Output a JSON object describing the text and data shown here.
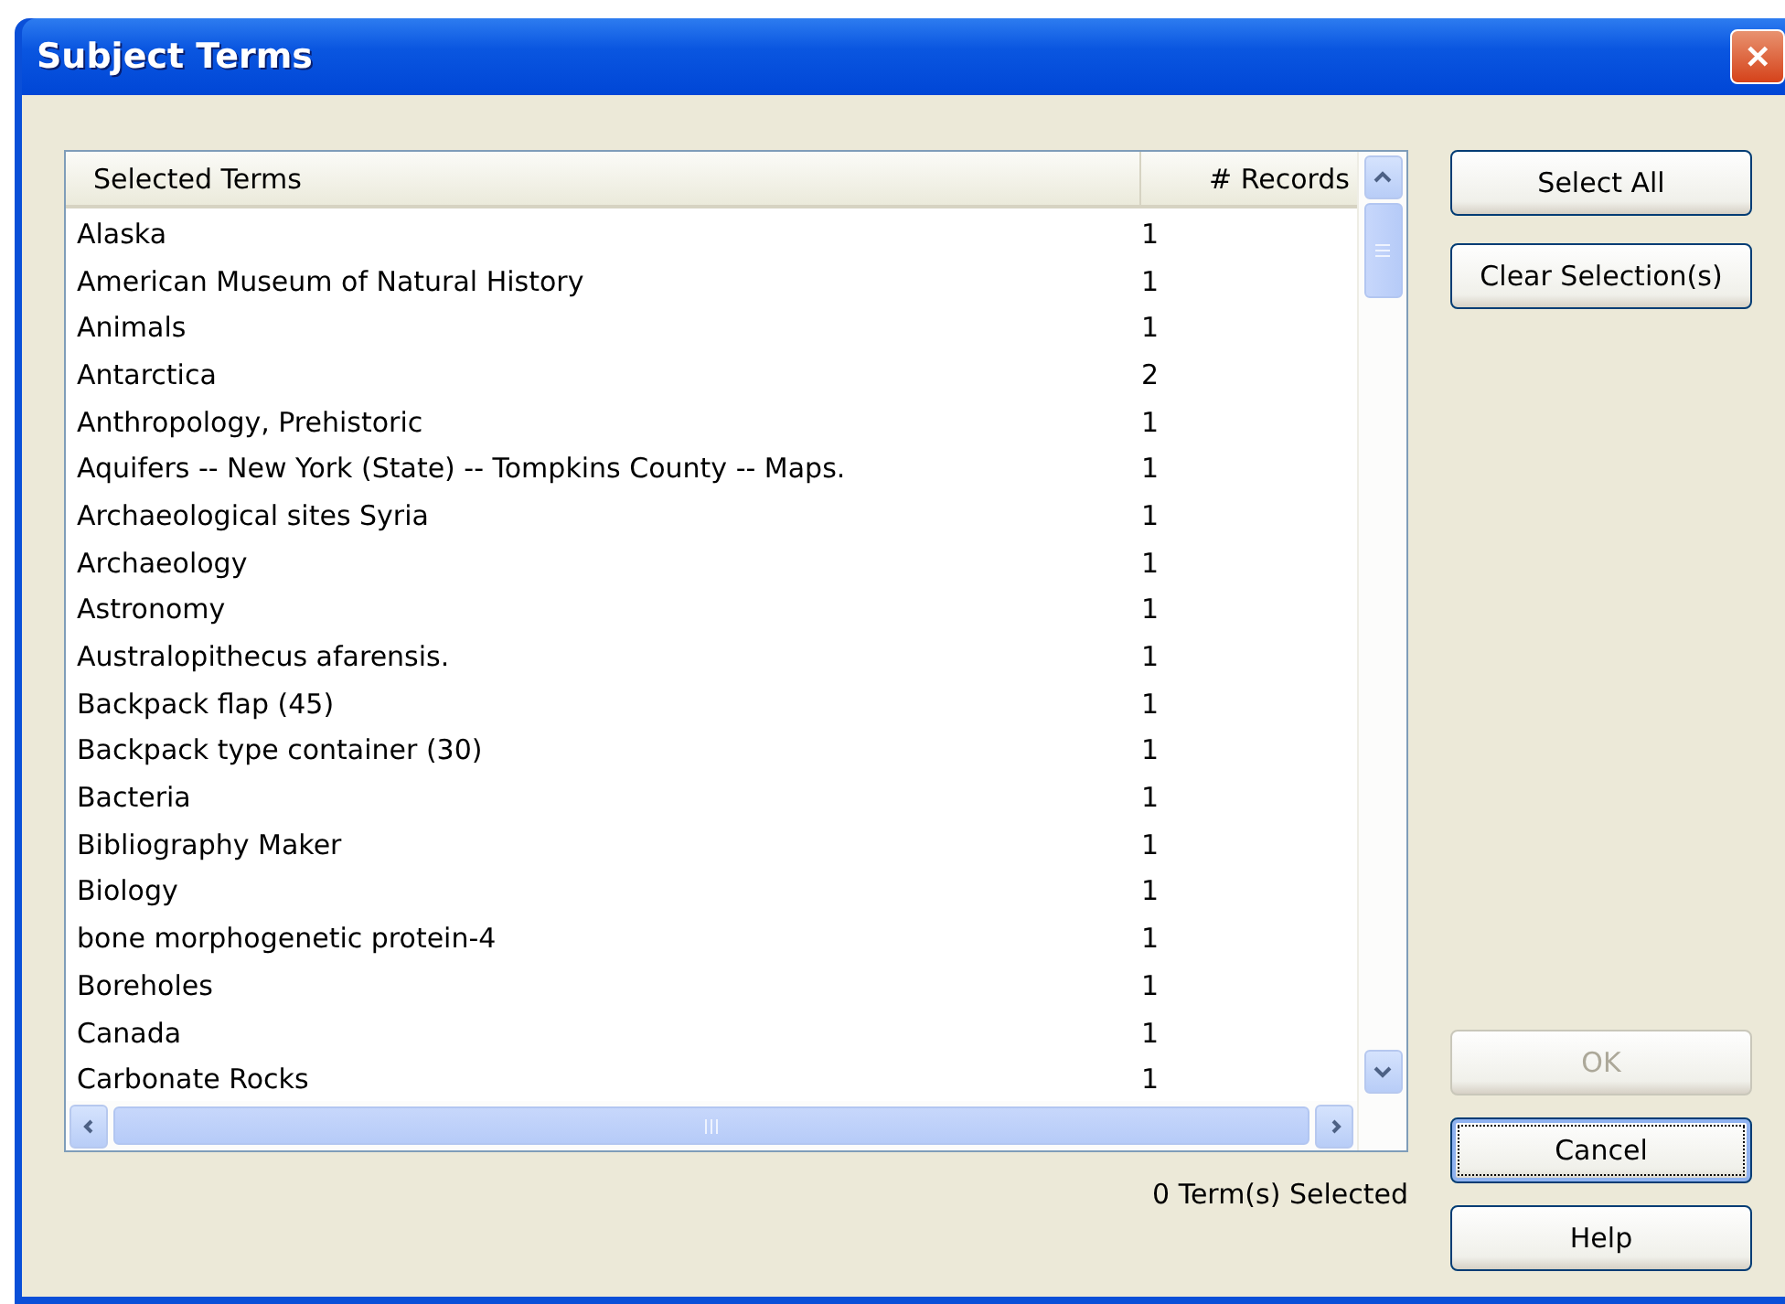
{
  "window": {
    "title": "Subject Terms",
    "close": "✕"
  },
  "table": {
    "columns": [
      "Selected Terms",
      "# Records"
    ],
    "rows": [
      {
        "term": "Alaska",
        "records": "1"
      },
      {
        "term": "American Museum of Natural History",
        "records": "1"
      },
      {
        "term": "Animals",
        "records": "1"
      },
      {
        "term": "Antarctica",
        "records": "2"
      },
      {
        "term": "Anthropology, Prehistoric",
        "records": "1"
      },
      {
        "term": "Aquifers -- New York (State) -- Tompkins County -- Maps.",
        "records": "1"
      },
      {
        "term": "Archaeological sites Syria",
        "records": "1"
      },
      {
        "term": "Archaeology",
        "records": "1"
      },
      {
        "term": "Astronomy",
        "records": "1"
      },
      {
        "term": "Australopithecus afarensis.",
        "records": "1"
      },
      {
        "term": "Backpack flap (45)",
        "records": "1"
      },
      {
        "term": "Backpack type container (30)",
        "records": "1"
      },
      {
        "term": "Bacteria",
        "records": "1"
      },
      {
        "term": "Bibliography Maker",
        "records": "1"
      },
      {
        "term": "Biology",
        "records": "1"
      },
      {
        "term": "bone morphogenetic protein-4",
        "records": "1"
      },
      {
        "term": "Boreholes",
        "records": "1"
      },
      {
        "term": "Canada",
        "records": "1"
      },
      {
        "term": "Carbonate Rocks",
        "records": "1"
      }
    ]
  },
  "status": "0 Term(s) Selected",
  "top_buttons": [
    {
      "label": "Select All",
      "disabled": false,
      "focused": false
    },
    {
      "label": "Clear Selection(s)",
      "disabled": false,
      "focused": false
    }
  ],
  "bottom_buttons": [
    {
      "label": "OK",
      "disabled": true,
      "focused": false
    },
    {
      "label": "Cancel",
      "disabled": false,
      "focused": true
    },
    {
      "label": "Help",
      "disabled": false,
      "focused": false
    }
  ]
}
